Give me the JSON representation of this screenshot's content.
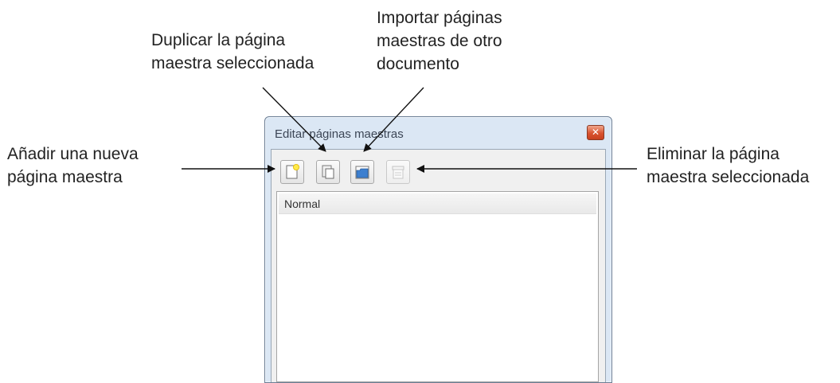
{
  "annotations": {
    "duplicate": [
      "Duplicar la página",
      "maestra seleccionada"
    ],
    "import": [
      "Importar páginas",
      "maestras de otro",
      "documento"
    ],
    "add": [
      "Añadir una nueva",
      "página maestra"
    ],
    "delete": [
      "Eliminar la página",
      "maestra seleccionada"
    ]
  },
  "dialog": {
    "title": "Editar páginas maestras",
    "close_icon": "close-icon",
    "toolbar": {
      "buttons": [
        {
          "name": "new-master-page",
          "icon": "new-page-icon",
          "enabled": true
        },
        {
          "name": "duplicate-master-page",
          "icon": "duplicate-page-icon",
          "enabled": true
        },
        {
          "name": "import-master-pages",
          "icon": "folder-icon",
          "enabled": true
        },
        {
          "name": "delete-master-page",
          "icon": "delete-icon",
          "enabled": false
        }
      ]
    },
    "list": {
      "items": [
        "Normal"
      ],
      "selected": "Normal"
    }
  },
  "colors": {
    "frame": "#dbe7f4",
    "close_button": "#d8532f",
    "text": "#222222",
    "selection": "#e9e9e9"
  }
}
